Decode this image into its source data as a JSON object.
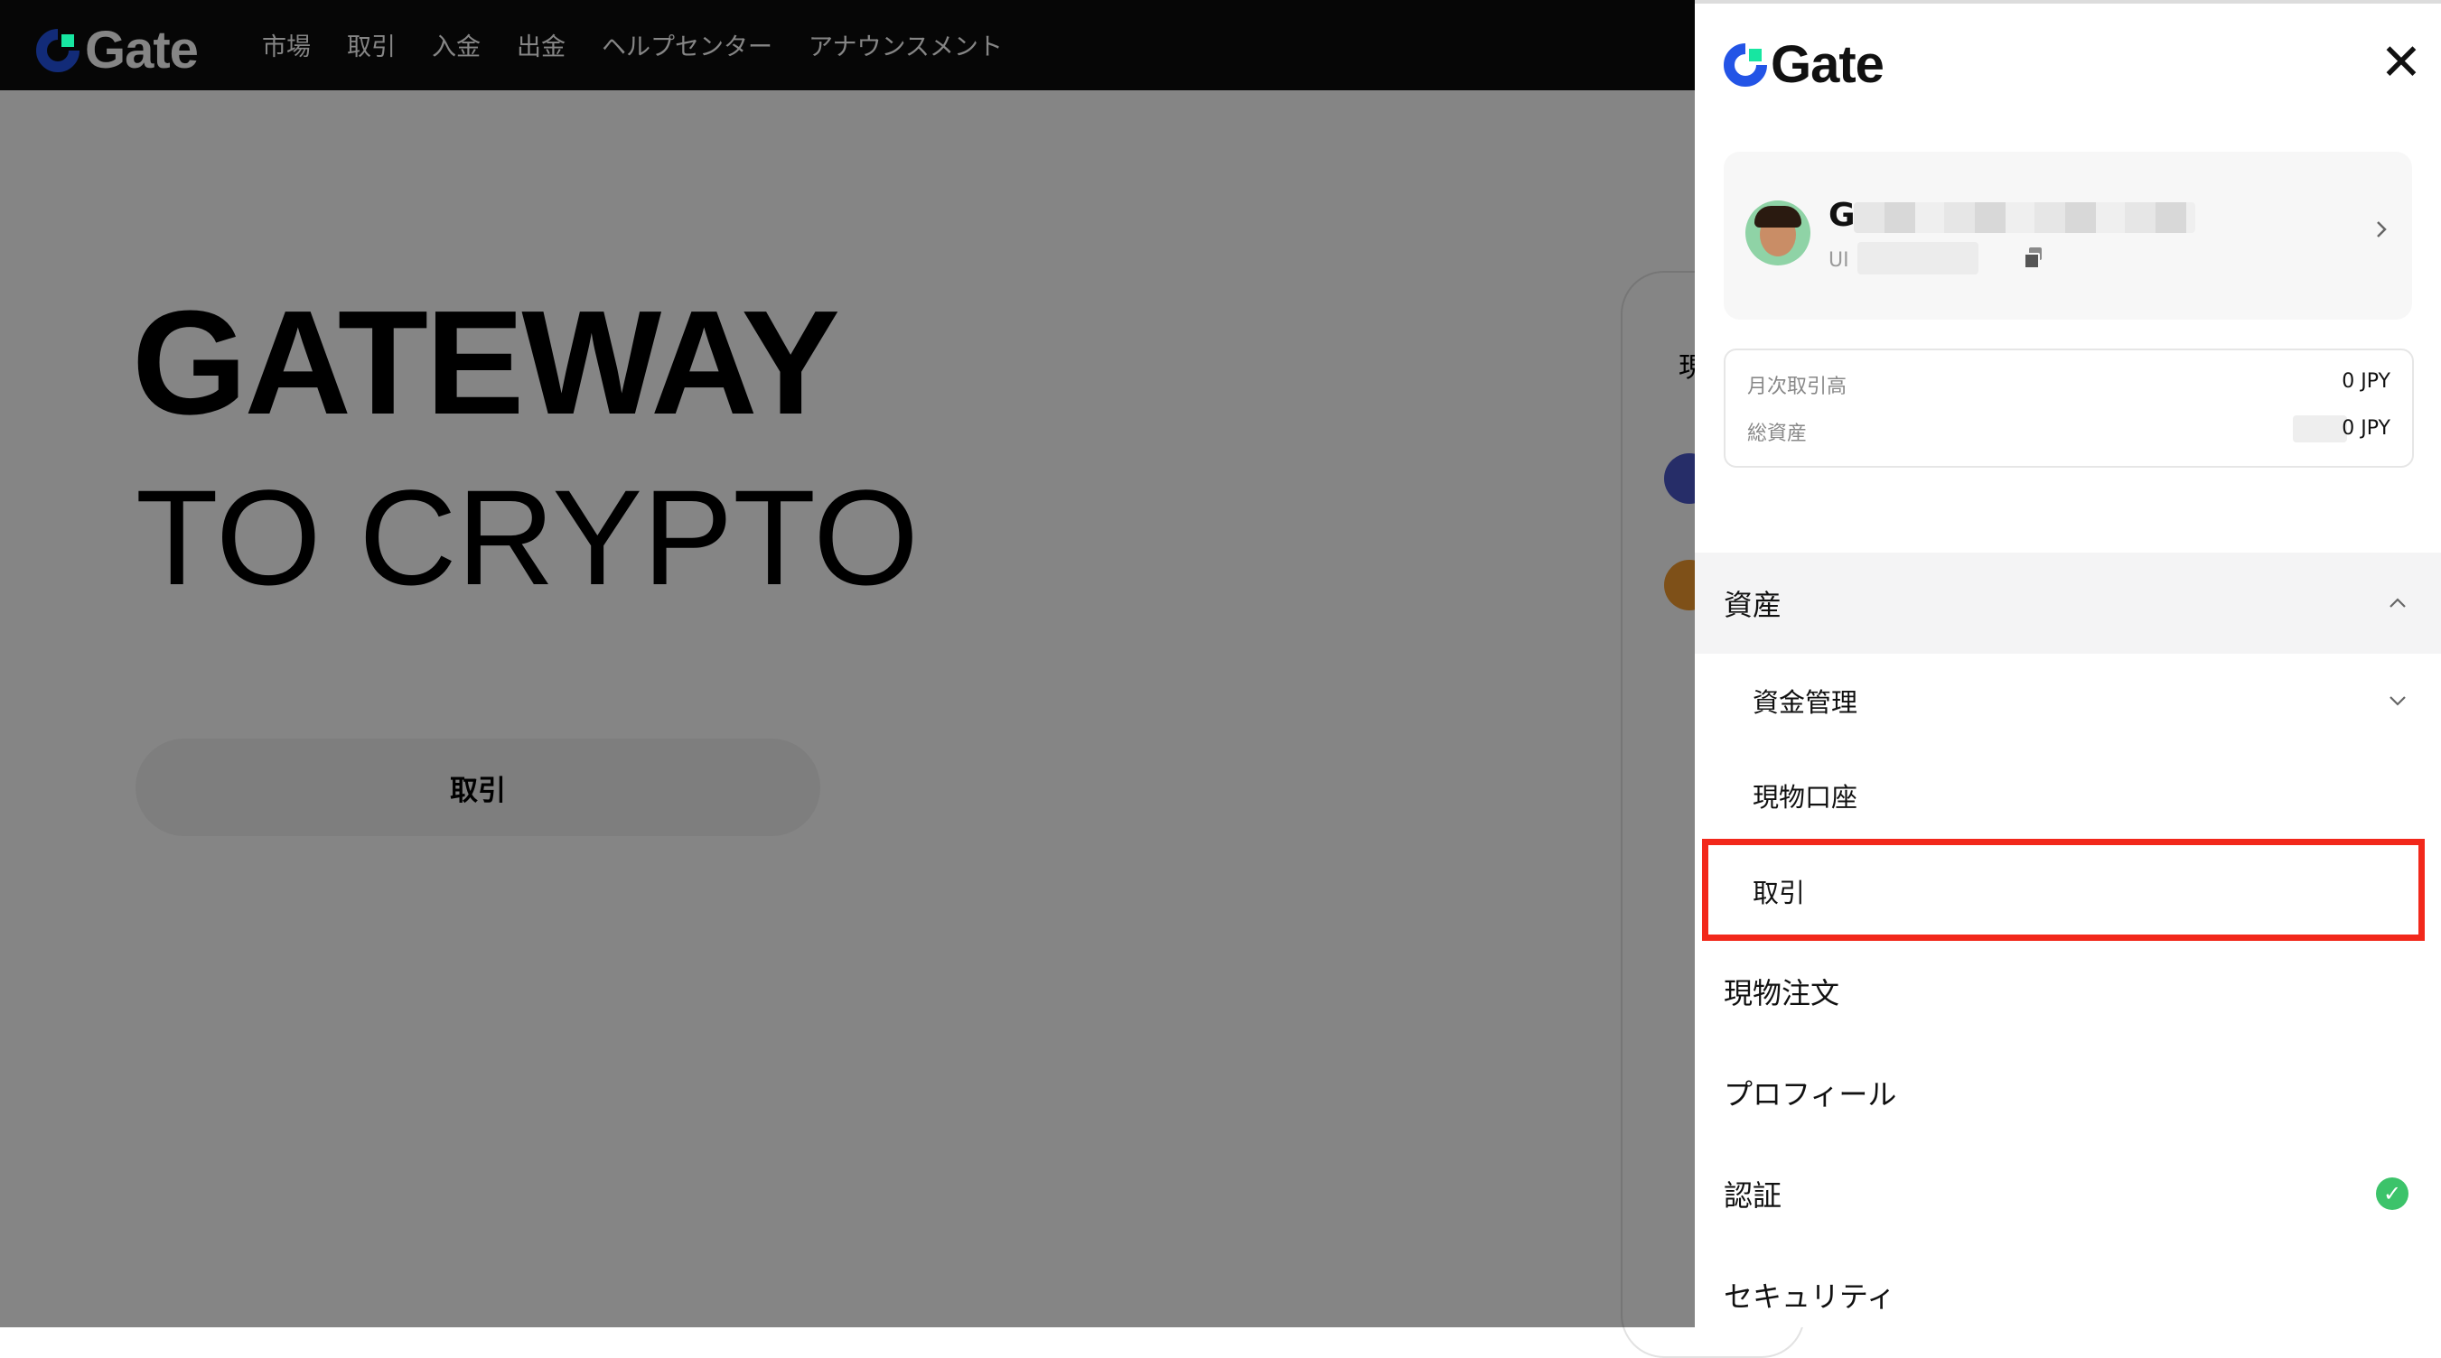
{
  "header": {
    "logo_text": "Gate",
    "nav": [
      "市場",
      "取引",
      "入金",
      "出金",
      "ヘルプセンター",
      "アナウンスメント"
    ]
  },
  "hero": {
    "line1": "GATEWAY",
    "line2_prefix": "TO ",
    "line2_highlight": "CRYPTO",
    "button_label": "取引"
  },
  "background_card": {
    "title_partial": "現"
  },
  "panel": {
    "logo_text": "Gate",
    "close_icon": "close-icon",
    "user": {
      "name_visible": "G",
      "uid_label": "UI"
    },
    "stats": {
      "monthly_label": "月次取引高",
      "monthly_value": "0 JPY",
      "total_label": "総資産",
      "total_value": "0 JPY"
    },
    "menu": {
      "assets": "資産",
      "funds_management": "資金管理",
      "spot_account": "現物口座",
      "trade": "取引",
      "spot_orders": "現物注文",
      "profile": "プロフィール",
      "verification": "認証",
      "security": "セキュリティ"
    }
  },
  "colors": {
    "brand_blue": "#2354e6",
    "brand_green": "#17e6a1",
    "highlight_green": "#9ce05c",
    "annotation_red": "#f2281b",
    "verified_green": "#3cc36a"
  }
}
